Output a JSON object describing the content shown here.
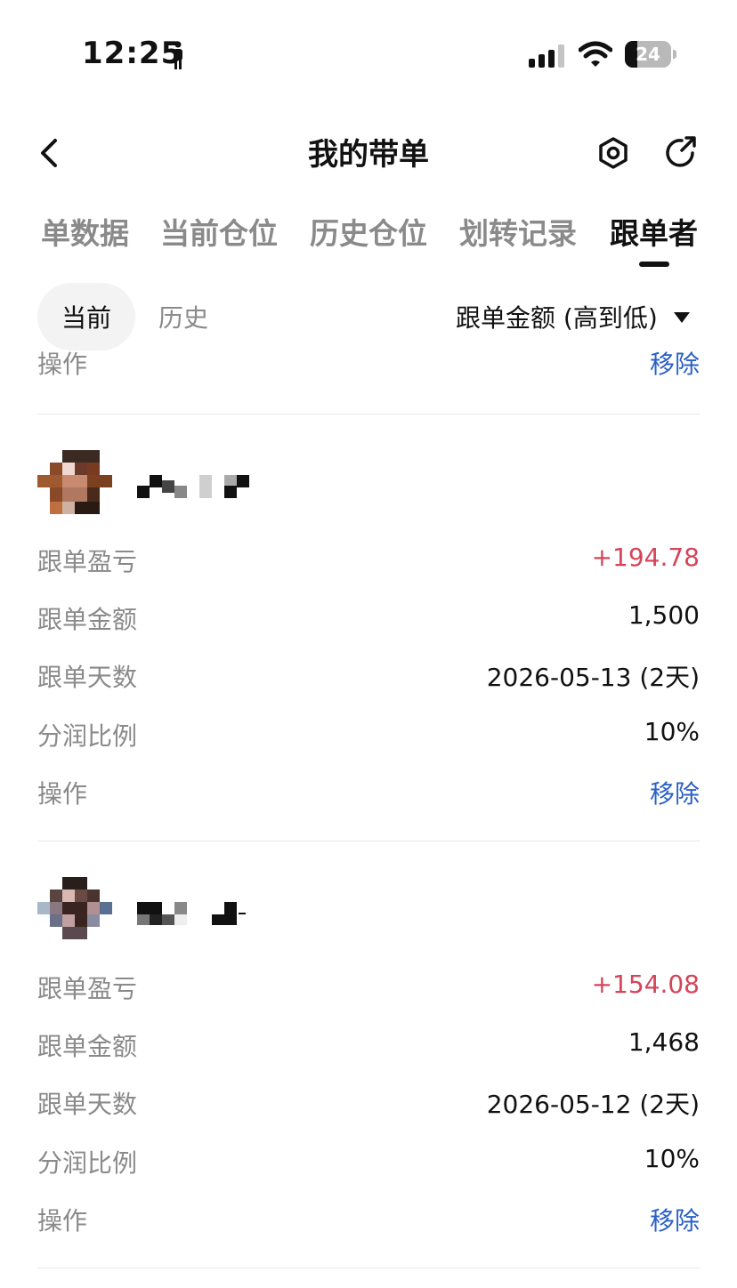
{
  "status_bar": {
    "time": "12:25",
    "battery": "24"
  },
  "header": {
    "title": "我的带单"
  },
  "tabs": [
    {
      "label": "单数据",
      "active": false
    },
    {
      "label": "当前仓位",
      "active": false
    },
    {
      "label": "历史仓位",
      "active": false
    },
    {
      "label": "划转记录",
      "active": false
    },
    {
      "label": "跟单者",
      "active": true
    }
  ],
  "filters": {
    "current": "当前",
    "history": "历史",
    "sort": "跟单金额 (高到低)"
  },
  "partial_row": {
    "label": "操作",
    "action": "移除"
  },
  "followers": [
    {
      "rows": [
        {
          "label": "跟单盈亏",
          "value": "+194.78"
        },
        {
          "label": "跟单金额",
          "value": "1,500"
        },
        {
          "label": "跟单天数",
          "value": "2026-05-13 (2天)"
        },
        {
          "label": "分润比例",
          "value": "10%"
        },
        {
          "label": "操作",
          "value": "移除"
        }
      ]
    },
    {
      "rows": [
        {
          "label": "跟单盈亏",
          "value": "+154.08"
        },
        {
          "label": "跟单金额",
          "value": "1,468"
        },
        {
          "label": "跟单天数",
          "value": "2026-05-12 (2天)"
        },
        {
          "label": "分润比例",
          "value": "10%"
        },
        {
          "label": "操作",
          "value": "移除"
        }
      ]
    }
  ],
  "colors": {
    "profit": "#d4455a",
    "action": "#2a60c8",
    "muted": "#8a8a8a"
  },
  "icons": [
    "person-icon",
    "signal-icon",
    "wifi-icon",
    "back-icon",
    "settings-icon",
    "share-icon",
    "caret-down-icon"
  ]
}
